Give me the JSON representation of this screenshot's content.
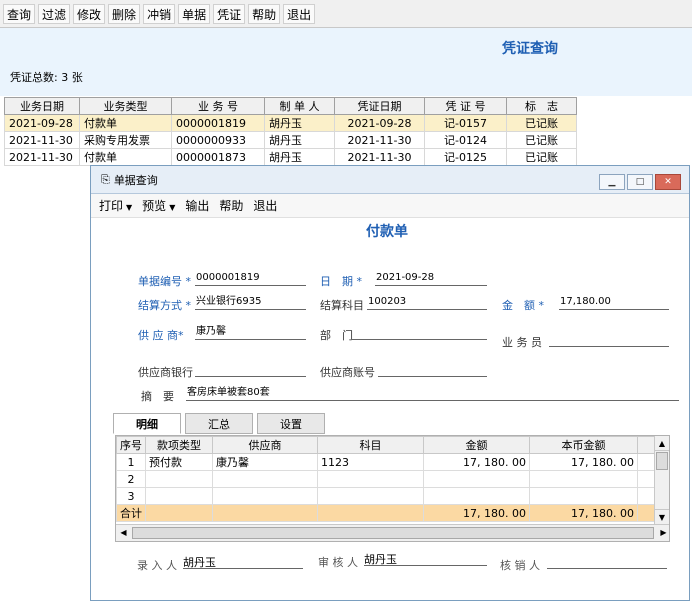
{
  "main": {
    "toolbar": [
      "查询",
      "过滤",
      "修改",
      "删除",
      "冲销",
      "单据",
      "凭证",
      "帮助",
      "退出"
    ],
    "title": "凭证查询",
    "total_label": "凭证总数: 3 张",
    "table": {
      "headers": [
        "业务日期",
        "业务类型",
        "业 务 号",
        "制 单 人",
        "凭证日期",
        "凭 证 号",
        "标　志"
      ],
      "rows": [
        [
          "2021-09-28",
          "付款单",
          "0000001819",
          "胡丹玉",
          "2021-09-28",
          "记-0157",
          "已记账"
        ],
        [
          "2021-11-30",
          "采购专用发票",
          "0000000933",
          "胡丹玉",
          "2021-11-30",
          "记-0124",
          "已记账"
        ],
        [
          "2021-11-30",
          "付款单",
          "0000001873",
          "胡丹玉",
          "2021-11-30",
          "记-0125",
          "已记账"
        ]
      ]
    }
  },
  "dialog": {
    "title": "单据查询",
    "toolbar": {
      "print": "打印",
      "preview": "预览",
      "output": "输出",
      "help": "帮助",
      "exit": "退出"
    },
    "form_title": "付款单",
    "fields": {
      "doc_no_label": "单据编号",
      "doc_no": "0000001819",
      "date_label": "日　期",
      "date": "2021-09-28",
      "settle_label": "结算方式",
      "settle": "兴业银行6935",
      "subject_label": "结算科目",
      "subject": "100203",
      "amount_label": "金　额",
      "amount": "17,180.00",
      "supplier_label": "供 应 商",
      "supplier": "康乃馨",
      "dept_label": "部　门",
      "dept": "",
      "clerk_label": "业 务 员",
      "clerk": "",
      "bank_label": "供应商银行",
      "bank": "",
      "account_label": "供应商账号",
      "account": "",
      "summary_label": "摘　要",
      "summary": "客房床单被套80套"
    },
    "tabs": [
      "明细",
      "汇总",
      "设置"
    ],
    "grid": {
      "headers": [
        "序号",
        "款项类型",
        "供应商",
        "科目",
        "金额",
        "本币金额"
      ],
      "rows": [
        [
          "1",
          "预付款",
          "康乃馨",
          "1123",
          "17, 180. 00",
          "17, 180. 00"
        ],
        [
          "2",
          "",
          "",
          "",
          "",
          ""
        ],
        [
          "3",
          "",
          "",
          "",
          "",
          ""
        ]
      ],
      "total": [
        "合计",
        "",
        "",
        "",
        "17, 180. 00",
        "17, 180. 00"
      ]
    },
    "signatures": {
      "entry_label": "录 入 人",
      "entry": "胡丹玉",
      "audit_label": "审 核 人",
      "audit": "胡丹玉",
      "writeoff_label": "核 销 人",
      "writeoff": ""
    }
  }
}
